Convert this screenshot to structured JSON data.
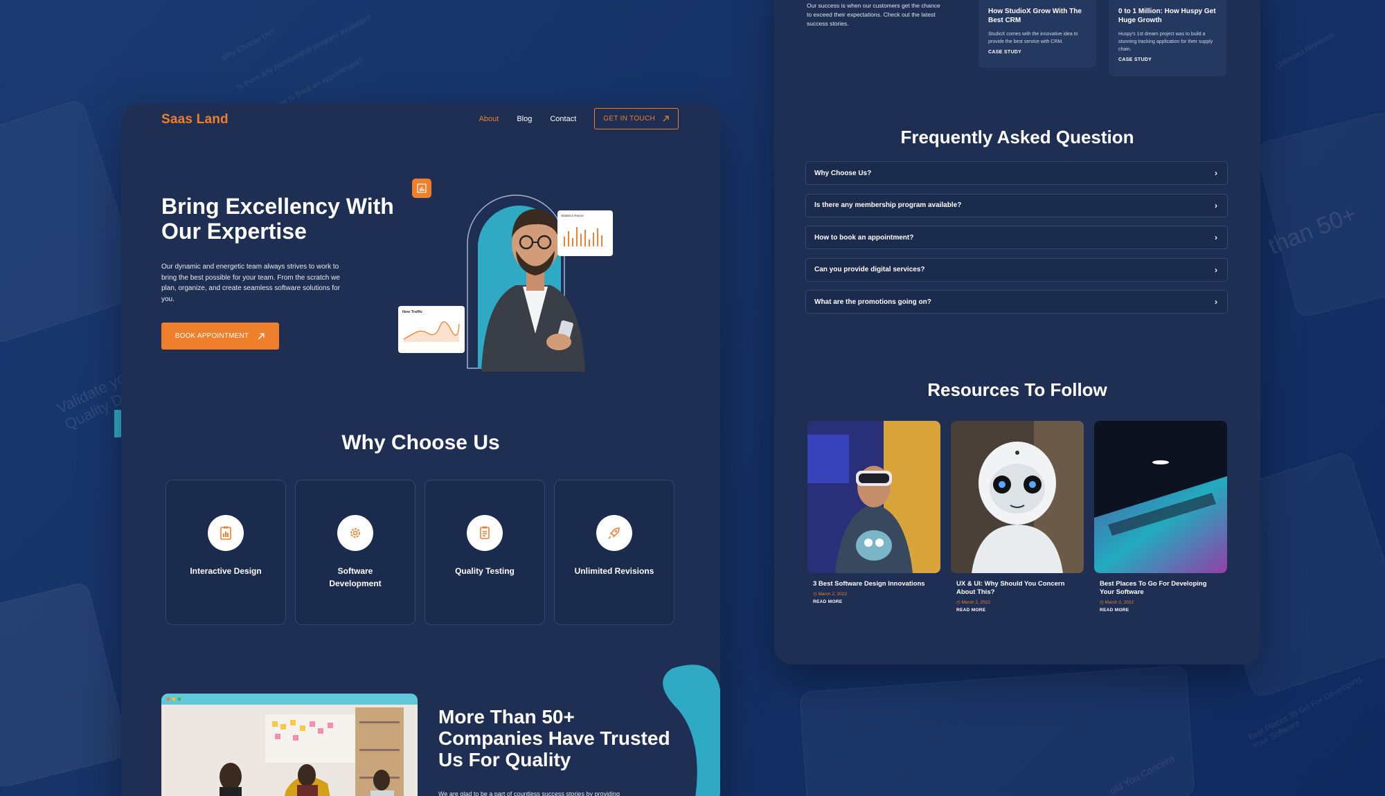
{
  "background": {
    "texts": [
      "Why Choose Us?",
      "Is there any membership program available?",
      "How to book an appointment?",
      "Validate your Quality D",
      "than 50+",
      "Unlimited Revisions",
      "Best Places To Go For Developing Your Software",
      "uld You Concern"
    ]
  },
  "left": {
    "logo": "Saas Land",
    "nav": [
      {
        "label": "About",
        "active": true
      },
      {
        "label": "Blog",
        "active": false
      },
      {
        "label": "Contact",
        "active": false
      }
    ],
    "cta_label": "GET IN TOUCH",
    "hero_title": "Bring Excellency With Our Expertise",
    "hero_text": "Our dynamic and energetic team always strives to work to bring the best possible for your team. From the scratch we plan, organize, and create seamless software solutions for you.",
    "book_label": "BOOK APPOINTMENT",
    "stats_card_title": "Statistics Report",
    "traffic_card_title": "New Traffic",
    "why_title": "Why Choose Us",
    "features": [
      {
        "label": "Interactive Design",
        "icon": "clipboard-chart-icon"
      },
      {
        "label": "Software Development",
        "icon": "gear-icon"
      },
      {
        "label": "Quality Testing",
        "icon": "checklist-icon"
      },
      {
        "label": "Unlimited Revisions",
        "icon": "rocket-icon"
      }
    ],
    "trust_title": "More Than 50+ Companies Have Trusted Us For Quality",
    "trust_text": "We are glad to be a part of countless success stories by providing"
  },
  "right": {
    "success_text": "Our success is when our customers get the chance to exceed their expectations. Check out the latest success stories.",
    "cases": [
      {
        "title": "How StudioX Grow With The Best CRM",
        "desc": "StudioX comes with the innovative idea to provide the best service with CRM.",
        "link": "CASE STUDY"
      },
      {
        "title": "0 to 1 Million: How Huspy Get Huge Growth",
        "desc": "Huspy's 1st dream project was to build a stunning tracking application for their supply chain.",
        "link": "CASE STUDY"
      }
    ],
    "faq_title": "Frequently Asked Question",
    "faqs": [
      "Why Choose Us?",
      "Is there any membership program available?",
      "How to book an appointment?",
      "Can you provide digital services?",
      "What are the promotions going on?"
    ],
    "resources_title": "Resources To Follow",
    "resources": [
      {
        "title": "3 Best Software Design Innovations",
        "date": "March 2, 2022",
        "more": "READ MORE"
      },
      {
        "title": "UX & UI: Why Should You Concern About This?",
        "date": "March 2, 2022",
        "more": "READ MORE"
      },
      {
        "title": "Best Places To Go For Developing Your Software",
        "date": "March 2, 2022",
        "more": "READ MORE"
      }
    ]
  },
  "colors": {
    "accent": "#f07f2c",
    "panel": "#1e2f53",
    "teal": "#2fa9c4"
  }
}
